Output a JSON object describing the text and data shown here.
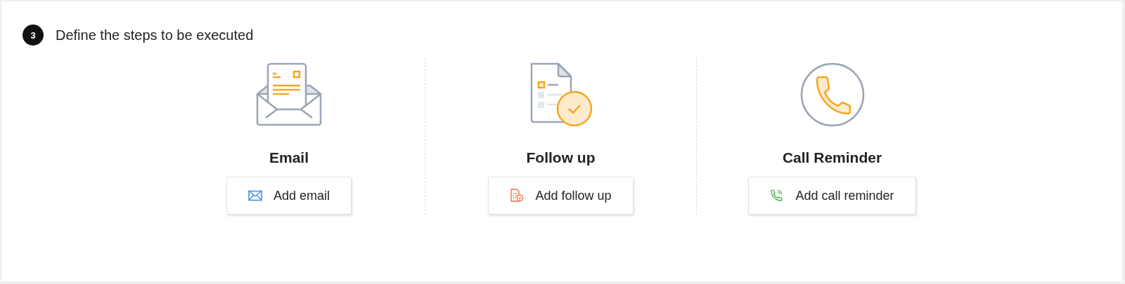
{
  "step": {
    "number": "3",
    "title": "Define the steps to be executed"
  },
  "actions": [
    {
      "kind": "email",
      "title": "Email",
      "button": "Add email"
    },
    {
      "kind": "followup",
      "title": "Follow up",
      "button": "Add follow up"
    },
    {
      "kind": "call",
      "title": "Call Reminder",
      "button": "Add call reminder"
    }
  ]
}
